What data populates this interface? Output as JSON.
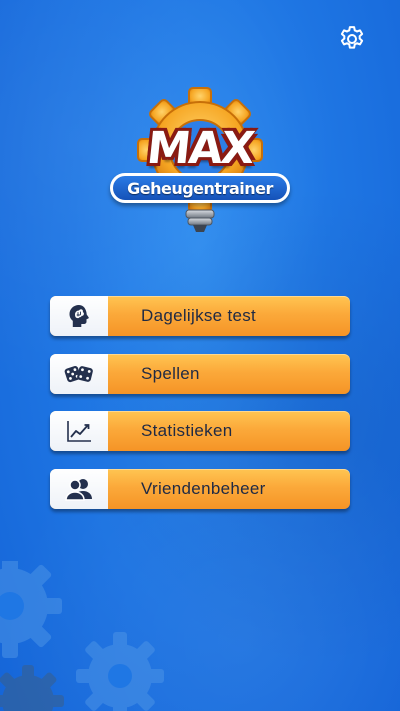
{
  "app": {
    "logo_title": "MAX",
    "logo_subtitle": "Geheugentrainer"
  },
  "header": {
    "settings_icon": "gear-icon"
  },
  "menu": {
    "items": [
      {
        "label": "Dagelijkse test",
        "icon": "head-brain-icon"
      },
      {
        "label": "Spellen",
        "icon": "dice-icon"
      },
      {
        "label": "Statistieken",
        "icon": "line-chart-icon"
      },
      {
        "label": "Vriendenbeheer",
        "icon": "users-icon"
      }
    ]
  },
  "colors": {
    "background": "#1f77e4",
    "button_orange": "#fba93a",
    "icon_dark": "#1f2a44",
    "logo_gear": "#f5a623"
  }
}
